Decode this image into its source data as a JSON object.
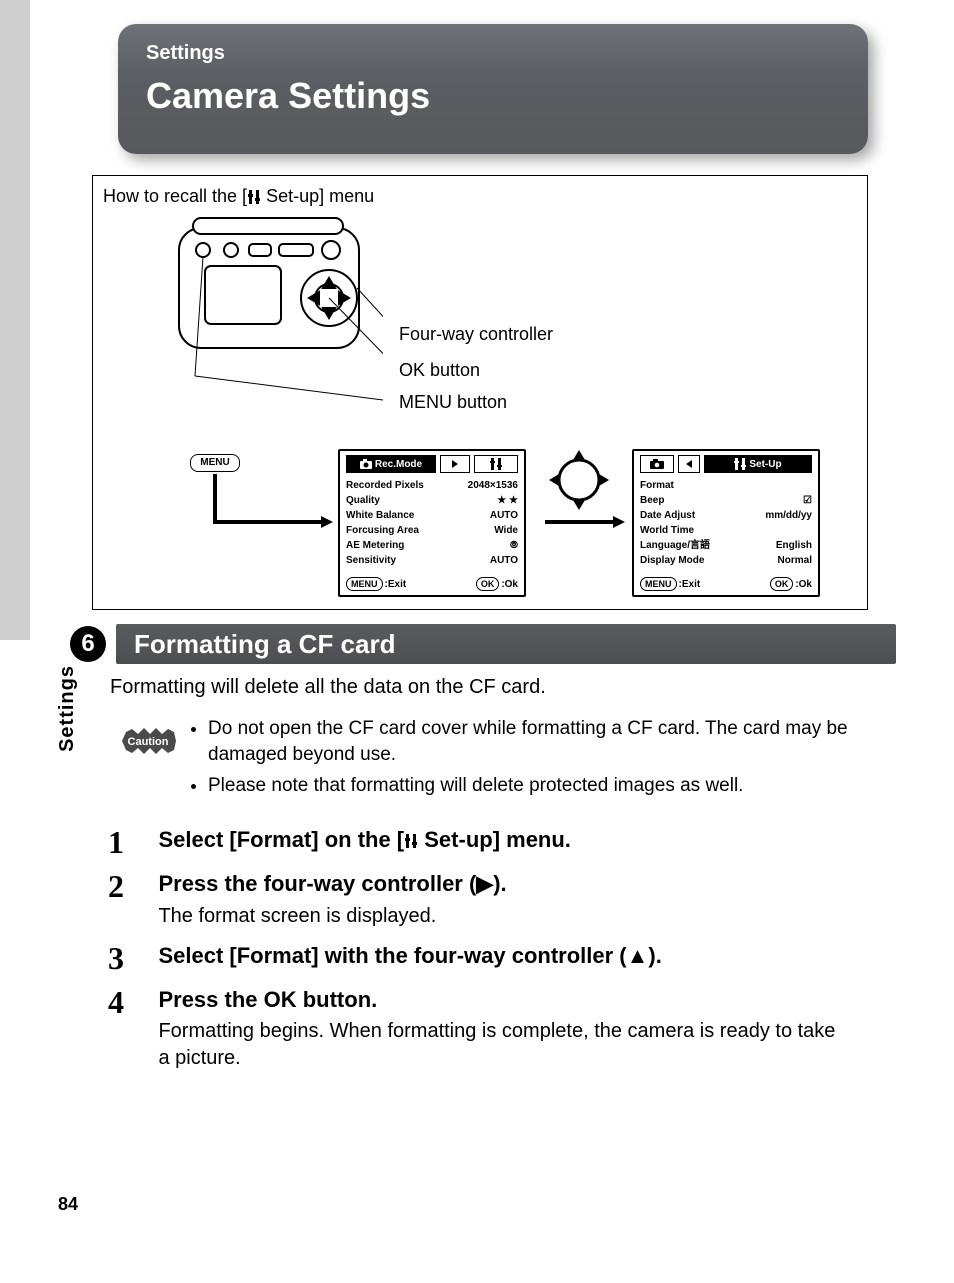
{
  "header": {
    "section": "Settings",
    "title": "Camera Settings"
  },
  "sidebar": {
    "chapter": "6",
    "label": "Settings"
  },
  "diagram": {
    "recall_prefix": "How to recall the [",
    "recall_suffix": " Set-up] menu",
    "fourway_label": "Four-way controller",
    "ok_label": "OK button",
    "menubtn_label": "MENU button",
    "menu_badge": "MENU",
    "lcd1": {
      "tab_label": "Rec.Mode",
      "rows": [
        {
          "label": "Recorded Pixels",
          "value": "2048×1536"
        },
        {
          "label": "Quality",
          "value": "★ ★"
        },
        {
          "label": "White Balance",
          "value": "AUTO"
        },
        {
          "label": "Forcusing Area",
          "value": "Wide"
        },
        {
          "label": "AE Metering",
          "value": "⦾"
        },
        {
          "label": "Sensitivity",
          "value": "AUTO"
        }
      ],
      "exit": "Exit",
      "ok": "Ok"
    },
    "lcd2": {
      "tab_label": "Set-Up",
      "rows": [
        {
          "label": "Format",
          "value": ""
        },
        {
          "label": "Beep",
          "value": "☑"
        },
        {
          "label": "Date Adjust",
          "value": "mm/dd/yy"
        },
        {
          "label": "World Time",
          "value": ""
        },
        {
          "label": "Language/言語",
          "value": "English"
        },
        {
          "label": "Display Mode",
          "value": "Normal"
        }
      ],
      "exit": "Exit",
      "ok": "Ok"
    }
  },
  "section_title": "Formatting a CF card",
  "intro": "Formatting will delete all the data on the CF card.",
  "caution_label": "Caution",
  "cautions": [
    "Do not open the CF card cover while formatting a CF card. The card may be damaged beyond use.",
    "Please note that formatting will delete protected images as well."
  ],
  "steps": {
    "s1": {
      "num": "1",
      "head_pre": "Select [Format] on the [",
      "head_post": " Set-up] menu."
    },
    "s2": {
      "num": "2",
      "head": "Press the four-way controller (▶).",
      "body": "The format screen is displayed."
    },
    "s3": {
      "num": "3",
      "head": "Select [Format] with the four-way controller (▲)."
    },
    "s4": {
      "num": "4",
      "head": "Press the OK button.",
      "body": "Formatting begins. When formatting is complete, the camera is ready to take a picture."
    }
  },
  "page_number": "84"
}
